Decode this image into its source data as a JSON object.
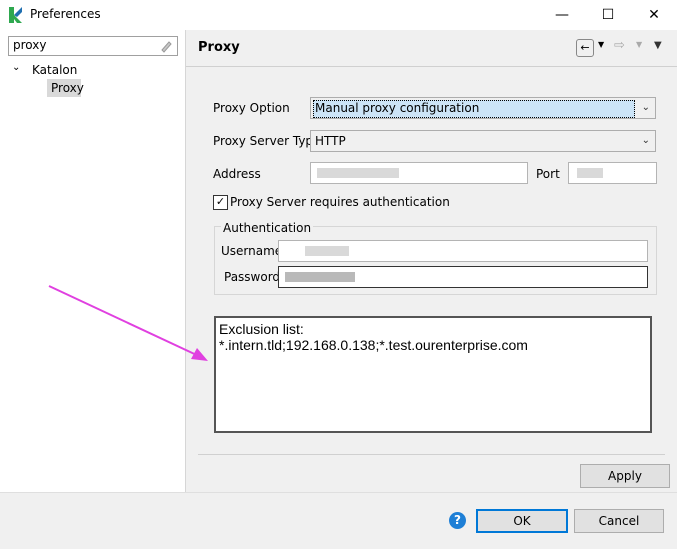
{
  "window": {
    "title": "Preferences",
    "minimize_glyph": "—",
    "maximize_glyph": "☐",
    "close_glyph": "✕"
  },
  "sidebar": {
    "filter_value": "proxy",
    "tree": {
      "root_label": "Katalon",
      "child_label": "Proxy"
    }
  },
  "page": {
    "title": "Proxy",
    "proxy_option": {
      "label": "Proxy Option",
      "value": "Manual proxy configuration"
    },
    "proxy_server_type": {
      "label": "Proxy Server Type",
      "value": "HTTP"
    },
    "address": {
      "label": "Address",
      "value": ""
    },
    "port": {
      "label": "Port",
      "value": ""
    },
    "requires_auth": {
      "label": "Proxy Server requires authentication",
      "checked": true
    },
    "authentication": {
      "group_label": "Authentication",
      "username_label": "Username",
      "username_value": "",
      "password_label": "Password",
      "password_value": ""
    },
    "exclusion": {
      "line1": "Exclusion list:",
      "line2": "*.intern.tld;192.168.0.138;*.test.ourenterprise.com"
    },
    "apply_label": "Apply"
  },
  "buttons": {
    "ok_label": "OK",
    "cancel_label": "Cancel",
    "help_glyph": "?"
  },
  "colors": {
    "arrow": "#e040e0",
    "help": "#1e7fd6",
    "ok_border": "#0078d7",
    "katalon_green": "#2ea84f",
    "katalon_blue": "#1f6fb0"
  }
}
